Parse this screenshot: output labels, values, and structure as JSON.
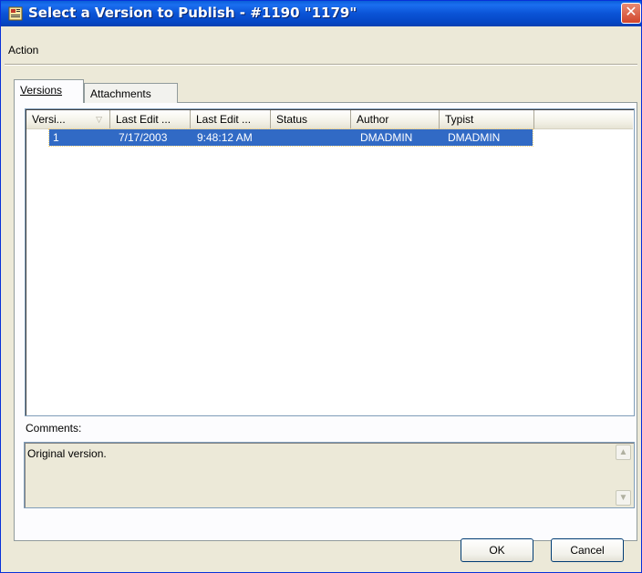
{
  "window": {
    "title": "Select a Version to Publish - #1190 \"1179\"",
    "close_label": "✕"
  },
  "menu": {
    "action_label": "Action"
  },
  "tabs": [
    {
      "label": "Versions",
      "active": true
    },
    {
      "label": "Attachments",
      "active": false
    }
  ],
  "list": {
    "columns": [
      "Versi...",
      "Last Edit ...",
      "Last Edit ...",
      "Status",
      "Author",
      "Typist"
    ],
    "sort_indicator": "▽",
    "rows": [
      {
        "version": "1",
        "date": "7/17/2003",
        "time": "9:48:12 AM",
        "status": "",
        "author": "DMADMIN",
        "typist": "DMADMIN",
        "selected": true
      }
    ]
  },
  "comments": {
    "label": "Comments:",
    "text": "Original version."
  },
  "buttons": {
    "ok_label": "OK",
    "cancel_label": "Cancel"
  },
  "colors": {
    "titlebar": "#0a53d6",
    "selection": "#316ac5",
    "close": "#d2452a",
    "face": "#ece9d8"
  }
}
